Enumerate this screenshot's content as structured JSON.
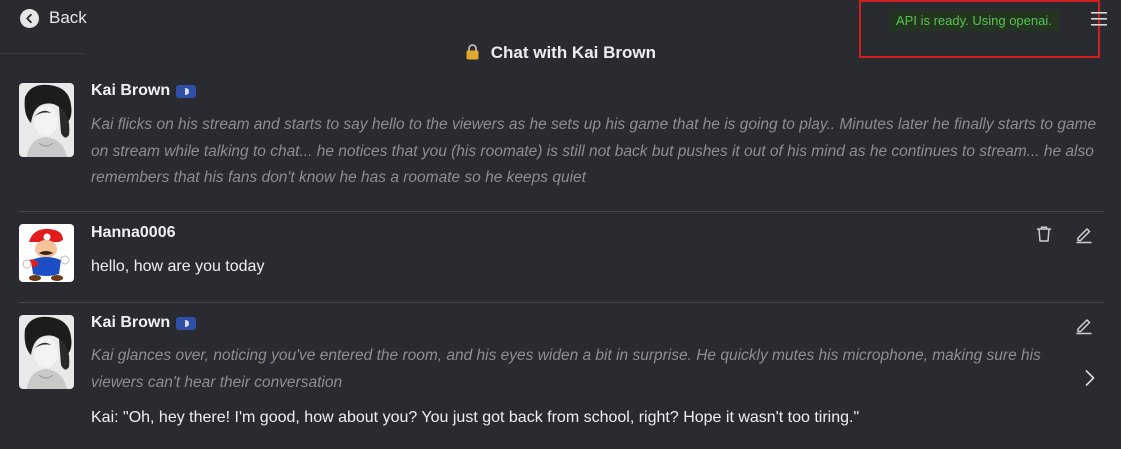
{
  "header": {
    "back_label": "Back",
    "title": "Chat with Kai Brown",
    "status": "API is ready. Using openai."
  },
  "messages": [
    {
      "author": "Kai Brown",
      "is_bot": true,
      "narration": "Kai flicks on his stream and starts to say hello to the viewers as he sets up his game that he is going to play.. Minutes later he finally starts to game on stream while talking to chat... he notices that you (his roomate) is still not back but pushes it out of his mind as he continues to stream... he also remembers that his fans don't know he has a roomate so he keeps quiet"
    },
    {
      "author": "Hanna0006",
      "is_bot": false,
      "text": "hello, how are you today"
    },
    {
      "author": "Kai Brown",
      "is_bot": true,
      "narration": "Kai glances over, noticing you've entered the room, and his eyes widen a bit in surprise. He quickly mutes his microphone, making sure his viewers can't hear their conversation",
      "text": "Kai: \"Oh, hey there! I'm good, how about you? You just got back from school, right? Hope it wasn't too tiring.\""
    }
  ],
  "colors": {
    "background": "#2a2b30",
    "status_bg": "#233521",
    "status_text": "#59c24f",
    "highlight_box": "#d11f1f",
    "bot_badge": "#2f4fa8"
  },
  "icons": {
    "back": "arrow-left-circle-icon",
    "lock": "lock-icon",
    "menu": "hamburger-menu-icon",
    "delete": "trash-icon",
    "edit": "pencil-icon",
    "next": "chevron-right-icon"
  }
}
